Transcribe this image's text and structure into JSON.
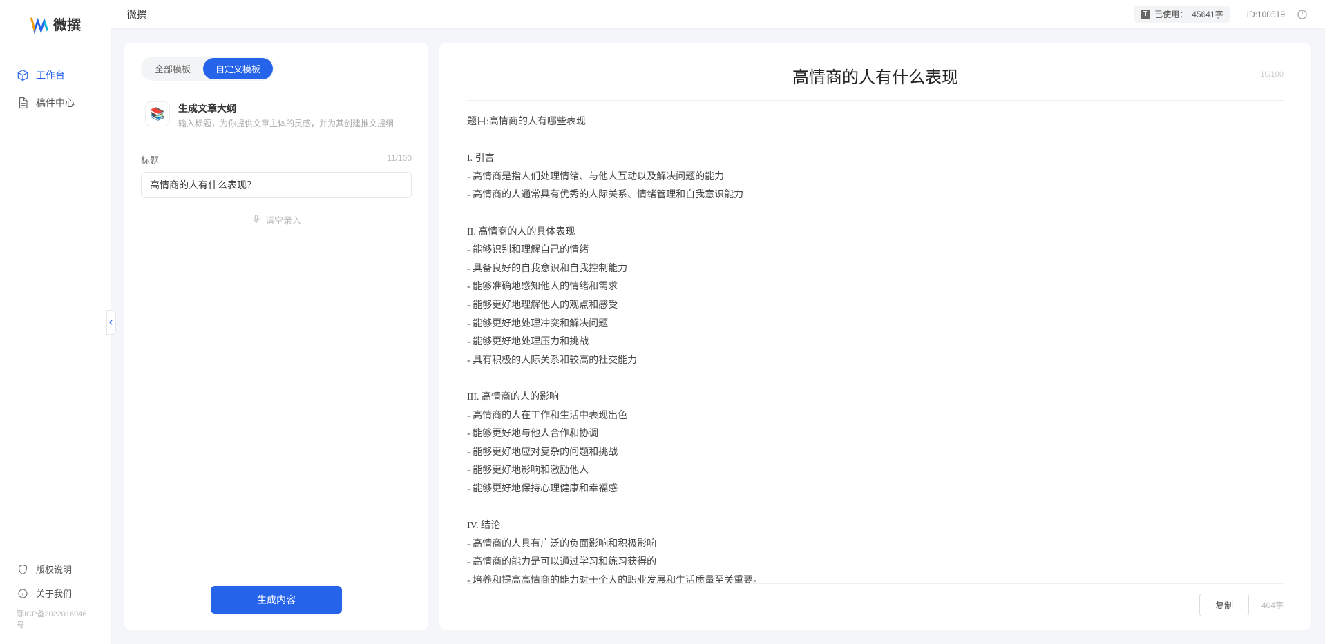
{
  "app": {
    "name": "微撰"
  },
  "topbar": {
    "title": "微撰",
    "usage_label": "已使用：",
    "usage_value": "45641字",
    "id_label": "ID:",
    "id_value": "100519"
  },
  "sidebar": {
    "items": [
      {
        "label": "工作台",
        "active": true,
        "icon": "cube-icon"
      },
      {
        "label": "稿件中心",
        "active": false,
        "icon": "file-icon"
      }
    ],
    "bottom": [
      {
        "label": "版权说明",
        "icon": "shield-icon"
      },
      {
        "label": "关于我们",
        "icon": "info-icon"
      }
    ],
    "icp": "鄂ICP备2022016946号"
  },
  "tabs": [
    {
      "label": "全部模板",
      "active": false
    },
    {
      "label": "自定义模板",
      "active": true
    }
  ],
  "template": {
    "title": "生成文章大纲",
    "desc": "输入标题，为你提供文章主体的灵感，并为其创建推文提纲"
  },
  "form": {
    "title_label": "标题",
    "title_count": "11/100",
    "title_value": "高情商的人有什么表现？",
    "voice_label": "请空录入"
  },
  "actions": {
    "generate": "生成内容",
    "copy": "复制"
  },
  "output": {
    "heading": "高情商的人有什么表现",
    "head_count": "10/100",
    "word_count": "404字",
    "body": "题目:高情商的人有哪些表现\n\nI. 引言\n- 高情商是指人们处理情绪、与他人互动以及解决问题的能力\n- 高情商的人通常具有优秀的人际关系、情绪管理和自我意识能力\n\nII. 高情商的人的具体表现\n- 能够识别和理解自己的情绪\n- 具备良好的自我意识和自我控制能力\n- 能够准确地感知他人的情绪和需求\n- 能够更好地理解他人的观点和感受\n- 能够更好地处理冲突和解决问题\n- 能够更好地处理压力和挑战\n- 具有积极的人际关系和较高的社交能力\n\nIII. 高情商的人的影响\n- 高情商的人在工作和生活中表现出色\n- 能够更好地与他人合作和协调\n- 能够更好地应对复杂的问题和挑战\n- 能够更好地影响和激励他人\n- 能够更好地保持心理健康和幸福感\n\nIV. 结论\n- 高情商的人具有广泛的负面影响和积极影响\n- 高情商的能力是可以通过学习和练习获得的\n- 培养和提高高情商的能力对于个人的职业发展和生活质量至关重要。"
  }
}
